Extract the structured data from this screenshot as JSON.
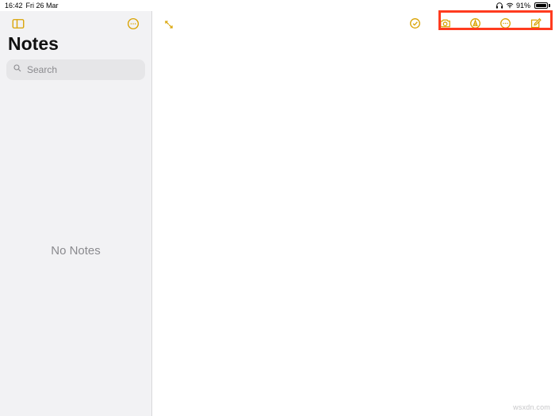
{
  "colors": {
    "accent": "#d9a200",
    "highlight": "#ff3b1f"
  },
  "status": {
    "time": "16:42",
    "date": "Fri 26 Mar",
    "battery_pct": "91%"
  },
  "sidebar": {
    "title": "Notes",
    "search_placeholder": "Search",
    "empty_text": "No Notes"
  },
  "watermark": "wsxdn.com"
}
